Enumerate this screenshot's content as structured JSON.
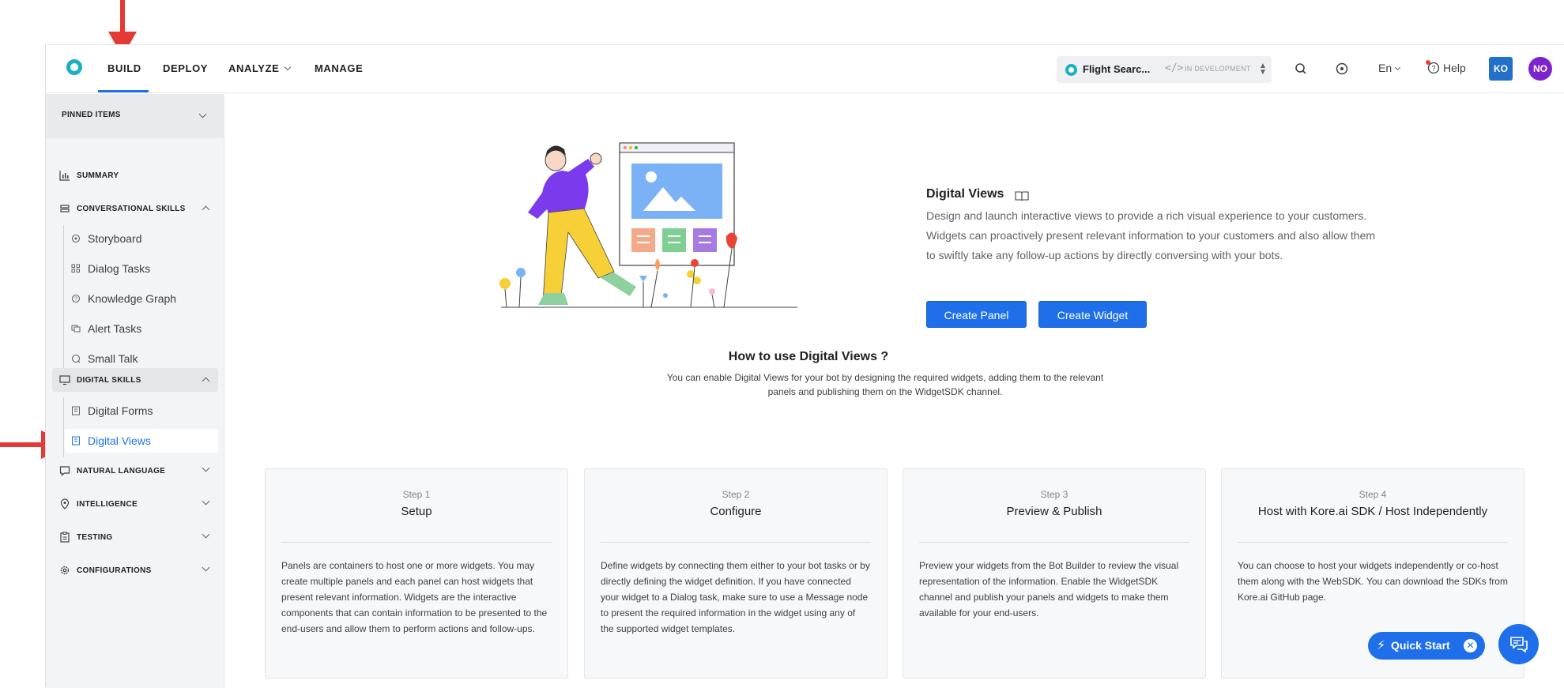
{
  "nav": {
    "build": "BUILD",
    "deploy": "DEPLOY",
    "analyze": "ANALYZE",
    "manage": "MANAGE"
  },
  "bot": {
    "name": "Flight Searc...",
    "code_glyph": "</>",
    "status": "IN DEVELOPMENT"
  },
  "header": {
    "language": "En",
    "help": "Help",
    "avatar1": "KO",
    "avatar2": "NO"
  },
  "sidebar": {
    "pinned": "PINNED ITEMS",
    "summary": "SUMMARY",
    "conversational": "CONVERSATIONAL SKILLS",
    "conv_items": [
      "Storyboard",
      "Dialog Tasks",
      "Knowledge Graph",
      "Alert Tasks",
      "Small Talk"
    ],
    "digital": "DIGITAL SKILLS",
    "digital_items": [
      "Digital Forms",
      "Digital Views"
    ],
    "natural_language": "NATURAL LANGUAGE",
    "intelligence": "INTELLIGENCE",
    "testing": "TESTING",
    "configurations": "CONFIGURATIONS"
  },
  "hero": {
    "title": "Digital Views",
    "description": "Design and launch interactive views to provide a rich visual experience to your customers. Widgets can proactively present relevant information to your customers and also allow them to swiftly take any follow-up actions by directly conversing with your bots.",
    "create_panel": "Create Panel",
    "create_widget": "Create Widget"
  },
  "how": {
    "title": "How to use Digital Views ?",
    "description": "You can enable Digital Views for your bot by designing the required widgets, adding them to the relevant panels and publishing them on the WidgetSDK channel."
  },
  "steps": [
    {
      "step": "Step 1",
      "title": "Setup",
      "body": "Panels are containers to host one or more widgets. You may create multiple panels and each panel can host widgets that present relevant information. Widgets are the interactive components that can contain information to be presented to the end-users and allow them to perform actions and follow-ups."
    },
    {
      "step": "Step 2",
      "title": "Configure",
      "body": "Define widgets by connecting them either to your bot tasks or by directly defining the widget definition. If you have connected your widget to a Dialog task, make sure to use a Message node to present the required information in the widget using any of the supported widget templates."
    },
    {
      "step": "Step 3",
      "title": "Preview & Publish",
      "body": "Preview your widgets from the Bot Builder to review the visual representation of the information. Enable the WidgetSDK channel and publish your panels and widgets to make them available for your end-users."
    },
    {
      "step": "Step 4",
      "title": "Host with Kore.ai SDK / Host Independently",
      "body": "You can choose to host your widgets independently or co-host them along with the WebSDK. You can download the SDKs from Kore.ai GitHub page."
    }
  ],
  "quickstart": {
    "label": "Quick Start",
    "close": "✕"
  },
  "colors": {
    "primary": "#1f6feb",
    "teal": "#1ab0c4",
    "annotation_arrow": "#e53935"
  }
}
